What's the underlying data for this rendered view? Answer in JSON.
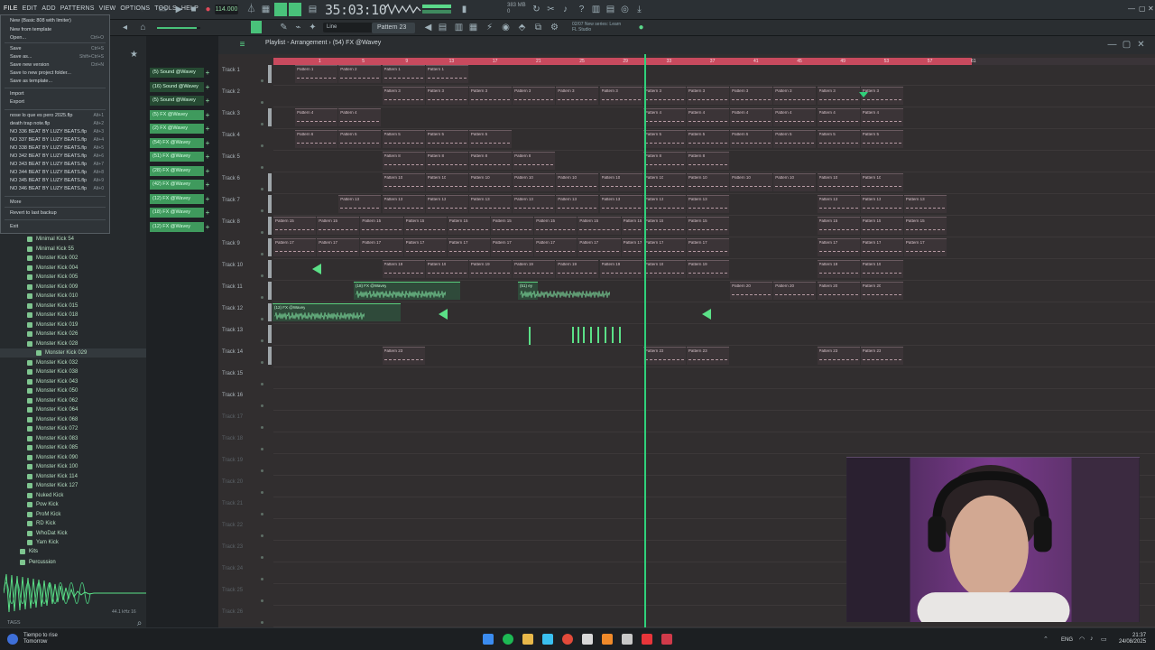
{
  "menu": {
    "items": [
      "FILE",
      "EDIT",
      "ADD",
      "PATTERNS",
      "VIEW",
      "OPTIONS",
      "TOOLS",
      "HELP"
    ]
  },
  "transport": {
    "tempo": "114.000",
    "song_time": "35:03:10",
    "memory": "383 MB",
    "cpu_line2": "0",
    "news_line1": "02/07  New series: Learn",
    "news_line2": "FL Studio"
  },
  "playlist": {
    "title": "Playlist - Arrangement › (54) FX @Wavey",
    "snap": "Line",
    "pattern": "Pattern 23",
    "ticks": [
      "1",
      "5",
      "9",
      "13",
      "17",
      "21",
      "25",
      "29",
      "33",
      "37",
      "41",
      "45",
      "49",
      "53",
      "57",
      "61"
    ],
    "tracks": [
      "Track 1",
      "Track 2",
      "Track 3",
      "Track 4",
      "Track 5",
      "Track 6",
      "Track 7",
      "Track 8",
      "Track 9",
      "Track 10",
      "Track 11",
      "Track 12",
      "Track 13",
      "Track 14",
      "Track 15",
      "Track 16",
      "Track 17",
      "Track 18",
      "Track 19",
      "Track 20",
      "Track 21",
      "Track 22",
      "Track 23",
      "Track 24",
      "Track 25",
      "Track 26"
    ],
    "clips": {
      "p1": "Pattern 1",
      "p2": "Pattern 2",
      "p3": "Pattern 3",
      "p4": "Pattern 4",
      "p5": "Pattern 5",
      "p6": "Pattern 6",
      "p8": "Pattern 8",
      "p10": "Pattern 10",
      "p13": "Pattern 13",
      "p14": "Pattern 14",
      "p15": "Pattern 15",
      "p16": "Pattern 16",
      "p17": "Pattern 17",
      "p19": "Pattern 19",
      "p20": "Pattern 20",
      "p23": "Pattern 23",
      "fx18": "(18) FX @Wavey",
      "fx12": "(12) FX @Wavey",
      "fx51": "(51) ey"
    }
  },
  "file_menu": {
    "items": [
      {
        "label": "New (Basic 808 with limiter)",
        "shortcut": ""
      },
      {
        "label": "New from template",
        "shortcut": ""
      },
      {
        "label": "Open...",
        "shortcut": "Ctrl+O"
      },
      {
        "label": "Save",
        "shortcut": "Ctrl+S"
      },
      {
        "label": "Save as...",
        "shortcut": "Shift+Ctrl+S"
      },
      {
        "label": "Save new version",
        "shortcut": "Ctrl+N"
      },
      {
        "label": "Save to new project folder...",
        "shortcut": ""
      },
      {
        "label": "Save as template...",
        "shortcut": ""
      },
      {
        "label": "Import",
        "shortcut": ""
      },
      {
        "label": "Export",
        "shortcut": ""
      },
      {
        "label": "nose lo que es pero 2025.flp",
        "shortcut": "Alt+1"
      },
      {
        "label": "death trap note.flp",
        "shortcut": "Alt+2"
      },
      {
        "label": "NO 336 BEAT BY LUZY BEATS.flp",
        "shortcut": "Alt+3"
      },
      {
        "label": "NO 337 BEAT BY LUZY BEATS.flp",
        "shortcut": "Alt+4"
      },
      {
        "label": "NO 338 BEAT BY LUZY BEATS.flp",
        "shortcut": "Alt+5"
      },
      {
        "label": "NO 342 BEAT BY LUZY BEATS.flp",
        "shortcut": "Alt+6"
      },
      {
        "label": "NO 343 BEAT BY LUZY BEATS.flp",
        "shortcut": "Alt+7"
      },
      {
        "label": "NO 344 BEAT BY LUZY BEATS.flp",
        "shortcut": "Alt+8"
      },
      {
        "label": "NO 345 BEAT BY LUZY BEATS.flp",
        "shortcut": "Alt+9"
      },
      {
        "label": "NO 346 BEAT BY LUZY BEATS.flp",
        "shortcut": "Alt+0"
      },
      {
        "label": "More",
        "shortcut": ""
      },
      {
        "label": "Revert to last backup",
        "shortcut": ""
      },
      {
        "label": "Exit",
        "shortcut": ""
      }
    ]
  },
  "channels": [
    "(5) Sound @Wavey",
    "(16) Sound @Wavey",
    "(5) Sound @Wavey",
    "(5) FX @Wavey",
    "(2) FX @Wavey",
    "(54) FX @Wavey",
    "(51) FX @Wavey",
    "(28) FX @Wavey",
    "(42) FX @Wavey",
    "(12) FX @Wavey",
    "(18) FX @Wavey",
    "(12) FX @Wavey"
  ],
  "browser": {
    "kicks": [
      "Minimal Kick 54",
      "Minimal Kick 55",
      "Monster Kick 002",
      "Monster Kick 004",
      "Monster Kick 005",
      "Monster Kick 009",
      "Monster Kick 010",
      "Monster Kick 015",
      "Monster Kick 018",
      "Monster Kick 019",
      "Monster Kick 026",
      "Monster Kick 028",
      "Monster Kick 029",
      "Monster Kick 032",
      "Monster Kick 038",
      "Monster Kick 043",
      "Monster Kick 050",
      "Monster Kick 062",
      "Monster Kick 064",
      "Monster Kick 068",
      "Monster Kick 072",
      "Monster Kick 083",
      "Monster Kick 085",
      "Monster Kick 090",
      "Monster Kick 100",
      "Monster Kick 114",
      "Monster Kick 127",
      "Nuked Kick",
      "Pow Kick",
      "ProM Kick",
      "RD Kick",
      "WhoDat Kick",
      "Yam Kick"
    ],
    "folders": [
      "Kits",
      "Percussion"
    ],
    "sample_info": "44.1 kHz 16",
    "tags": "TAGS"
  },
  "taskbar": {
    "weather_line1": "Tiempo to rise",
    "weather_line2": "Tomorrow",
    "tray": "ENG",
    "time": "21:37",
    "date": "24/08/2025"
  },
  "colors": {
    "accent": "#49c27a",
    "timeline": "#c84a5e",
    "playhead": "#2fd07a"
  }
}
